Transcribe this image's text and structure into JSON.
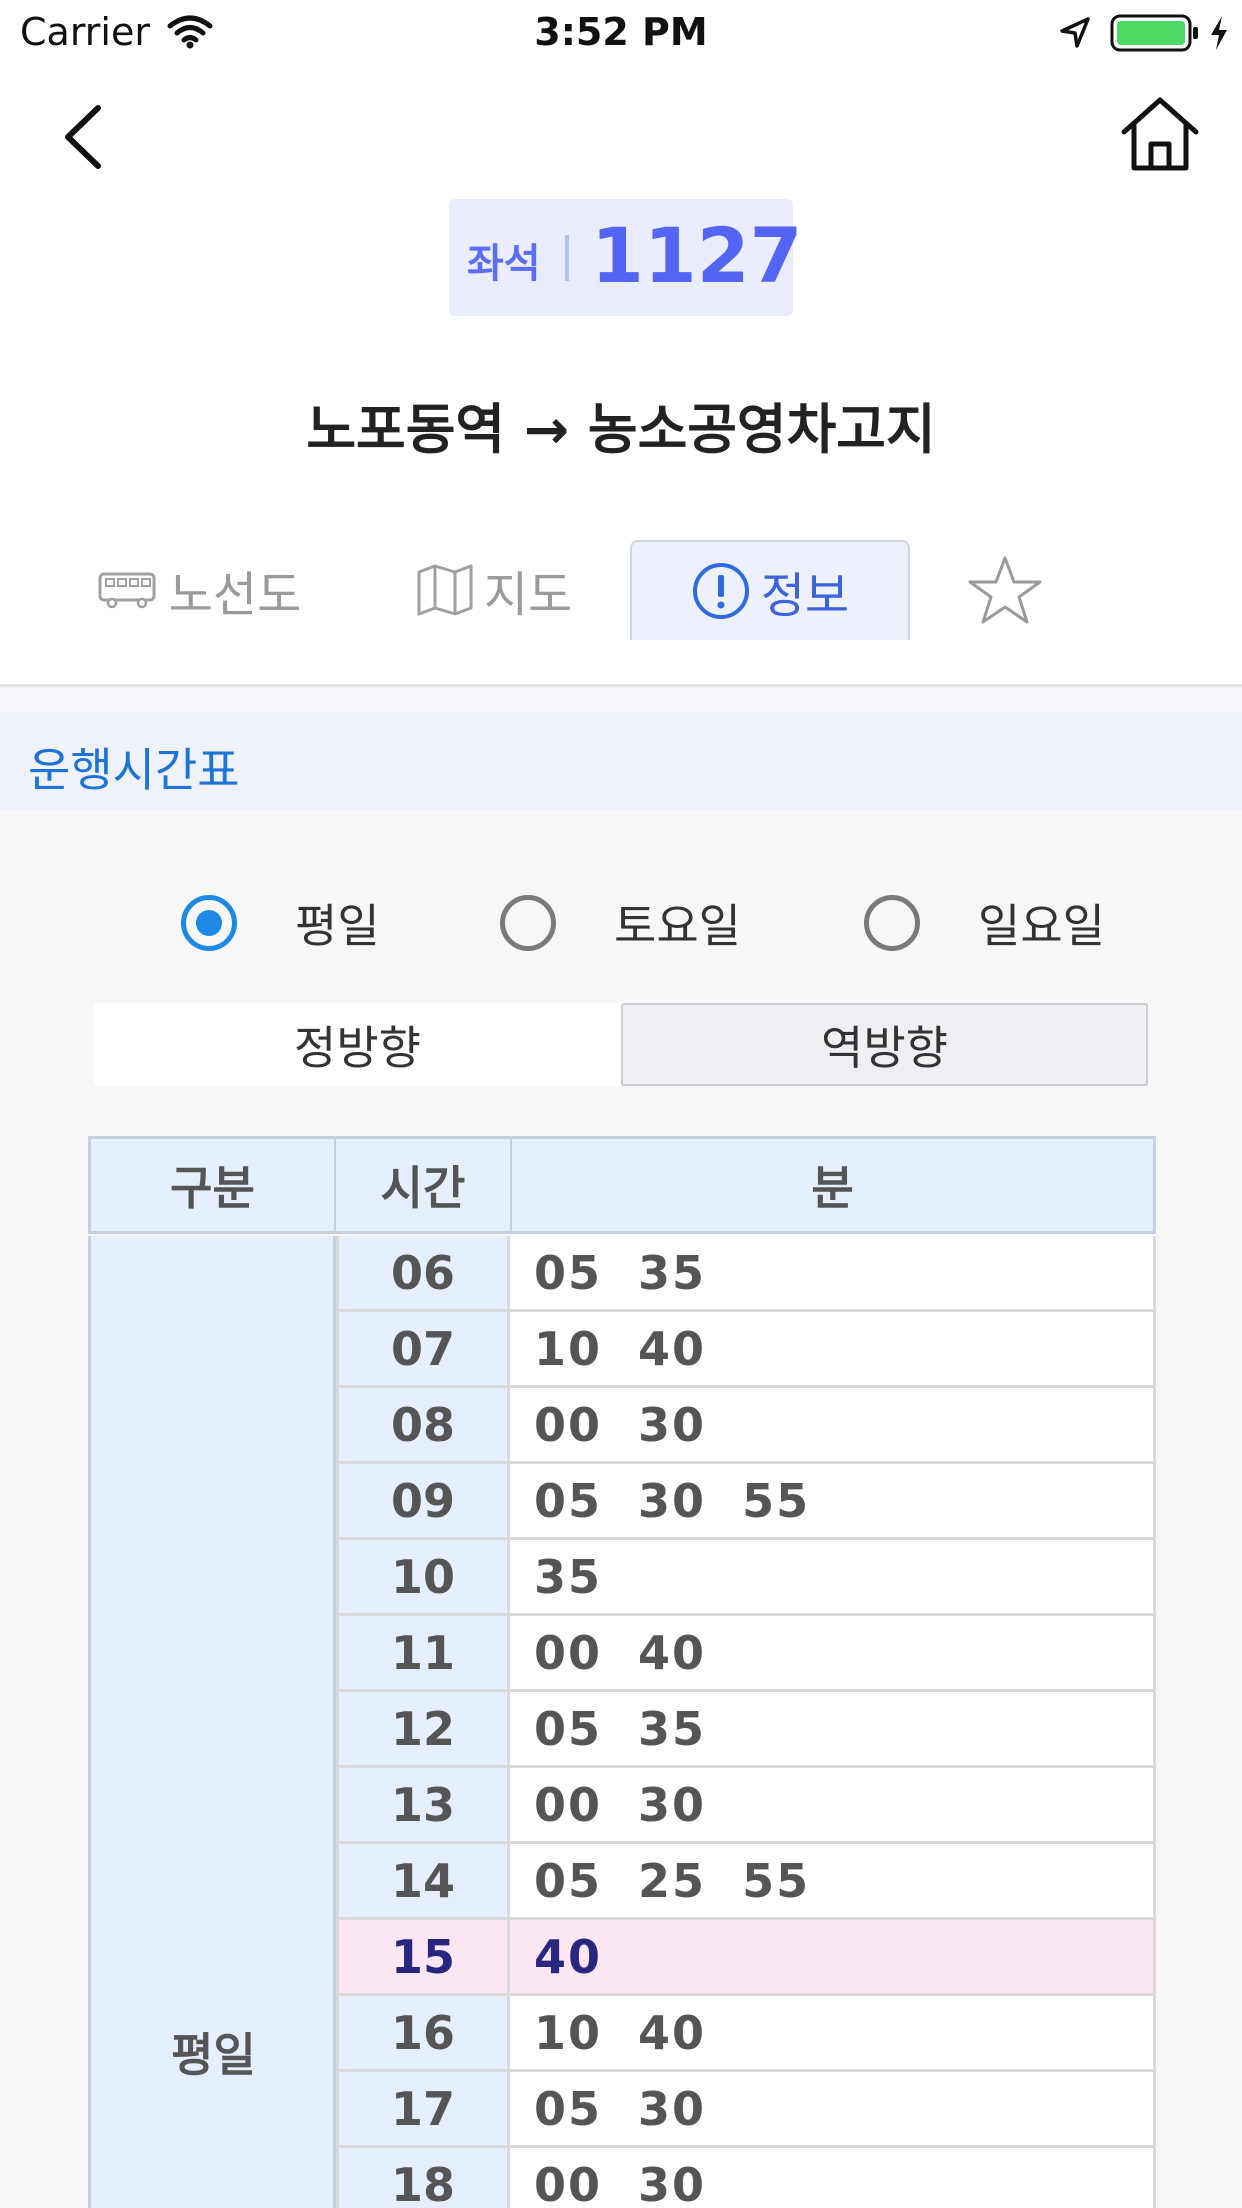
{
  "status_bar": {
    "carrier": "Carrier",
    "time": "3:52 PM"
  },
  "header": {
    "badge_type": "좌석",
    "route_number": "1127",
    "route_title": "노포동역 → 농소공영차고지"
  },
  "tabs": [
    {
      "label": "노선도",
      "icon": "bus-icon"
    },
    {
      "label": "지도",
      "icon": "map-icon"
    },
    {
      "label": "정보",
      "icon": "info-icon",
      "active": true
    },
    {
      "label": "",
      "icon": "star-icon"
    }
  ],
  "section": {
    "title": "운행시간표"
  },
  "day_options": [
    {
      "label": "평일",
      "selected": true
    },
    {
      "label": "토요일",
      "selected": false
    },
    {
      "label": "일요일",
      "selected": false
    }
  ],
  "direction_tabs": [
    {
      "label": "정방향",
      "selected": true
    },
    {
      "label": "역방향",
      "selected": false
    }
  ],
  "timetable": {
    "columns": [
      "구분",
      "시간",
      "분"
    ],
    "category": "평일",
    "rows": [
      {
        "hour": "06",
        "minutes": "05  35"
      },
      {
        "hour": "07",
        "minutes": "10  40"
      },
      {
        "hour": "08",
        "minutes": "00  30"
      },
      {
        "hour": "09",
        "minutes": "05  30  55"
      },
      {
        "hour": "10",
        "minutes": "35"
      },
      {
        "hour": "11",
        "minutes": "00  40"
      },
      {
        "hour": "12",
        "minutes": "05  35"
      },
      {
        "hour": "13",
        "minutes": "00  30"
      },
      {
        "hour": "14",
        "minutes": "05  25  55"
      },
      {
        "hour": "15",
        "minutes": "40",
        "highlighted": true
      },
      {
        "hour": "16",
        "minutes": "10  40"
      },
      {
        "hour": "17",
        "minutes": "05  30"
      },
      {
        "hour": "18",
        "minutes": "00  30"
      }
    ]
  },
  "colors": {
    "accent": "#1e88e5",
    "badge_text": "#5565f3",
    "highlight_row": "#fde6f4"
  }
}
